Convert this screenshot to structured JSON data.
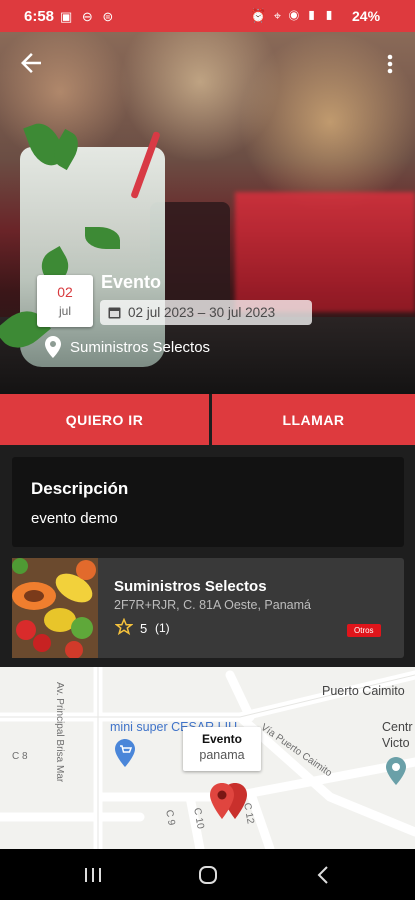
{
  "status_bar": {
    "time": "6:58",
    "battery": "24%"
  },
  "event": {
    "title": "Evento",
    "day": "02",
    "month": "jul",
    "date_range": "02 jul 2023 – 30 jul 2023",
    "venue": "Suministros Selectos"
  },
  "actions": {
    "go_label": "QUIERO IR",
    "call_label": "LLAMAR"
  },
  "description": {
    "heading": "Descripción",
    "text": "evento demo"
  },
  "supplier": {
    "name": "Suministros Selectos",
    "address": "2F7R+RJR, C. 81A Oeste, Panamá",
    "rating": "5",
    "reviews": "(1)",
    "tag": "Otros"
  },
  "map": {
    "marker_title": "Evento",
    "marker_subtitle": "panama",
    "labels": {
      "puerto_caimito": "Puerto Caimito",
      "mini_super": "mini super CESAR LIU",
      "via_puerto_caimito": "Vía Puerto Caimito",
      "av_principal": "Av. Principal Brisa Mar",
      "centro": "Centr",
      "victo": "Victo",
      "c8": "C 8",
      "c9": "C 9",
      "c10": "C 10",
      "c12": "C 12"
    }
  },
  "colors": {
    "accent": "#de3a3e",
    "tag_red": "#e0151b",
    "card_dark": "#121212",
    "card_gray": "#393939"
  }
}
